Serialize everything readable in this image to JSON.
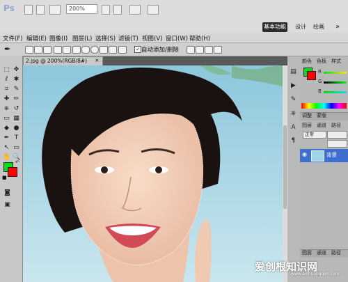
{
  "app": {
    "logo": "Ps",
    "zoom": "200%",
    "workspaces": [
      "基本功能",
      "设计",
      "绘画",
      "»"
    ]
  },
  "menu": [
    "文件(F)",
    "编辑(E)",
    "图像(I)",
    "图层(L)",
    "选择(S)",
    "滤镜(T)",
    "视图(V)",
    "窗口(W)",
    "帮助(H)"
  ],
  "options": {
    "auto_add_label": "自动添加/删除",
    "auto_add_checked": "✓"
  },
  "document": {
    "tab_title": "2.jpg @ 200%(RGB/8#)",
    "close": "×"
  },
  "tools": {
    "foreground_color": "#00e01c",
    "background_color": "#ff0000",
    "icons": [
      "marquee-icon",
      "move-icon",
      "lasso-icon",
      "magic-wand-icon",
      "crop-icon",
      "eyedropper-icon",
      "healing-icon",
      "brush-icon",
      "stamp-icon",
      "history-brush-icon",
      "eraser-icon",
      "gradient-icon",
      "blur-icon",
      "dodge-icon",
      "pen-icon",
      "type-icon",
      "path-select-icon",
      "shape-icon",
      "hand-icon",
      "zoom-icon"
    ],
    "glyphs": [
      "⬚",
      "✥",
      "ℓ",
      "✱",
      "⌗",
      "✎",
      "✚",
      "✏",
      "⎈",
      "↺",
      "▭",
      "▦",
      "◆",
      "●",
      "✒",
      "T",
      "↖",
      "▭",
      "✋",
      "🔍"
    ]
  },
  "panels": {
    "color_tabs": [
      "颜色",
      "色板",
      "样式"
    ],
    "channel_labels": [
      "R",
      "G",
      "B"
    ],
    "adjust_tabs": [
      "调整",
      "蒙版"
    ],
    "layers_tabs": [
      "图层",
      "通道",
      "路径"
    ],
    "blend_mode": "正常",
    "layer_name": "背景",
    "bottom_tabs": [
      "图层",
      "通道",
      "路径"
    ]
  },
  "watermark": {
    "text": "爱创根知识网",
    "url": "www.aichuanggen.com"
  }
}
